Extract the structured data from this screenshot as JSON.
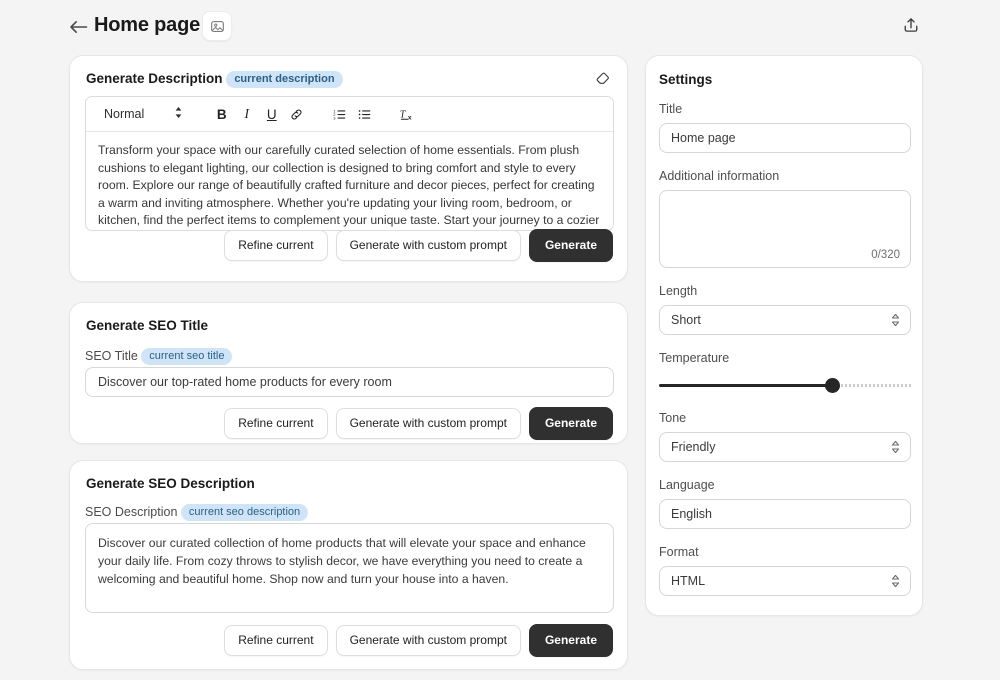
{
  "header": {
    "back_icon": "arrow-left-icon",
    "title": "Home page",
    "image_icon": "image-icon",
    "share_icon": "share-export-icon"
  },
  "cards": {
    "description": {
      "title": "Generate Description",
      "chip": "current description",
      "eraser_icon": "eraser-icon",
      "toolbar": {
        "style": "Normal",
        "bold": "B",
        "italic": "I",
        "underline": "U",
        "link": "link-icon",
        "ordered_list": "ordered-list-icon",
        "bullet_list": "bullet-list-icon",
        "clear_format": "clear-format-icon"
      },
      "body": "Transform your space with our carefully curated selection of home essentials. From plush cushions to elegant lighting, our collection is designed to bring comfort and style to every room. Explore our range of beautifully crafted furniture and decor pieces, perfect for creating a warm and inviting atmosphere. Whether you're updating your living room, bedroom, or kitchen, find the perfect items to complement your unique taste. Start your journey to a cozier home today!",
      "buttons": {
        "refine": "Refine current",
        "custom": "Generate with custom prompt",
        "generate": "Generate"
      }
    },
    "seo_title": {
      "title": "Generate SEO Title",
      "label": "SEO Title",
      "chip": "current seo title",
      "value": "Discover our top-rated home products for every room",
      "buttons": {
        "refine": "Refine current",
        "custom": "Generate with custom prompt",
        "generate": "Generate"
      }
    },
    "seo_description": {
      "title": "Generate SEO Description",
      "label": "SEO Description",
      "chip": "current seo description",
      "value": "Discover our curated collection of home products that will elevate your space and enhance your daily life. From cozy throws to stylish decor, we have everything you need to create a welcoming and beautiful home. Shop now and turn your house into a haven.",
      "buttons": {
        "refine": "Refine current",
        "custom": "Generate with custom prompt",
        "generate": "Generate"
      }
    }
  },
  "settings": {
    "title": "Settings",
    "title_label": "Title",
    "title_value": "Home page",
    "additional_label": "Additional information",
    "additional_value": "",
    "additional_counter": "0/320",
    "length_label": "Length",
    "length_value": "Short",
    "temperature_label": "Temperature",
    "temperature_percent": 69,
    "tone_label": "Tone",
    "tone_value": "Friendly",
    "language_label": "Language",
    "language_value": "English",
    "format_label": "Format",
    "format_value": "HTML"
  },
  "colors": {
    "background": "#f4f4f4",
    "card": "#ffffff",
    "primary_button": "#303030",
    "chip_bg": "#cfe5f7",
    "chip_text": "#2b5f86"
  }
}
